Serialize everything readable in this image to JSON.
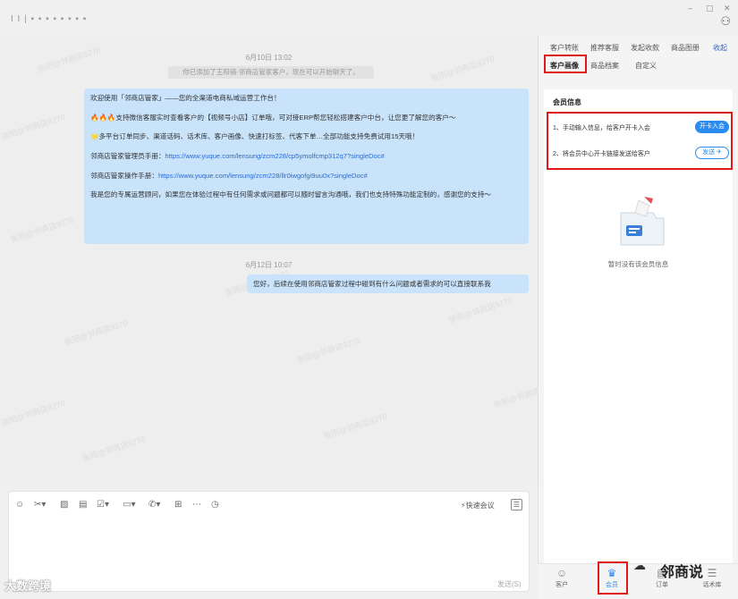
{
  "window": {
    "title": "I I | ▪ ▪ ▪ ▪ ▪ ▪ ▪ ▪",
    "controls": [
      "–",
      "▢",
      "✕"
    ]
  },
  "chat": {
    "watermark_text": "张阳@邻商店9270",
    "time1": "6月10日 13:02",
    "system_msg": "你已添加了王阳骑-邻商店管家客户，现在可以开始聊天了。",
    "msg1": {
      "p1": "欢迎使用「邻商店管家」——您的全渠道电商私域运营工作台！",
      "p2": "🔥🔥🔥支持微信客服实时查看客户的【视频号小店】订单哦，可对接ERP帮您轻松搭建客户中台，让您更了解您的客户～",
      "p3": "🌟多平台订单同步、渠道话码、话术库、客户画像、快速打标签、代客下单…全部功能支持免费试用15天哦！",
      "p4_label": "邻商店管家管理员手册：",
      "p4_link": "https://www.yuque.com/lensung/zcm228/cp5ymolfcmp312q7?singleDoc#",
      "p5_label": "邻商店管家操作手册：",
      "p5_link": "https://www.yuque.com/lensung/zcm228/llr0iwgofgi9uu0x?singleDoc#",
      "p6": "我是您的专属运营顾问，如果您在体验过程中有任何需求或问题都可以随时留言沟通哦，我们也支持特殊功能定制的，感谢您的支持～"
    },
    "time2": "6月12日 10:07",
    "msg2": "您好，后续在使用邻商店管家过程中碰到有什么问题或者需求的可以直接联系我"
  },
  "input": {
    "quick_meeting": "快速会议",
    "send": "发送(S)"
  },
  "corner_logo": "大数跨境",
  "right_panel": {
    "tabs_row1": [
      "客户转账",
      "推荐客服",
      "发起收款",
      "商品图册"
    ],
    "collapse": "收起",
    "tabs_row2": [
      "客户画像",
      "商品档案",
      "自定义"
    ],
    "card_title": "会员信息",
    "step1": "1、手动输入信息，给客户开卡入会",
    "step1_btn": "开卡入会",
    "step2": "2、将会员中心开卡链接发送给客户",
    "step2_btn": "发送 ✈",
    "empty_text": "暂时没有该会员信息"
  },
  "bottom_nav": [
    {
      "label": "客户",
      "icon": "☺"
    },
    {
      "label": "会员",
      "icon": "♛"
    },
    {
      "label": "订单",
      "icon": "▤"
    },
    {
      "label": "话术库",
      "icon": "☰"
    }
  ],
  "brand": "邻商说",
  "colors": {
    "accent": "#2a8cf0",
    "bubble": "#c9e3fb",
    "highlight_frame": "#e01818"
  }
}
